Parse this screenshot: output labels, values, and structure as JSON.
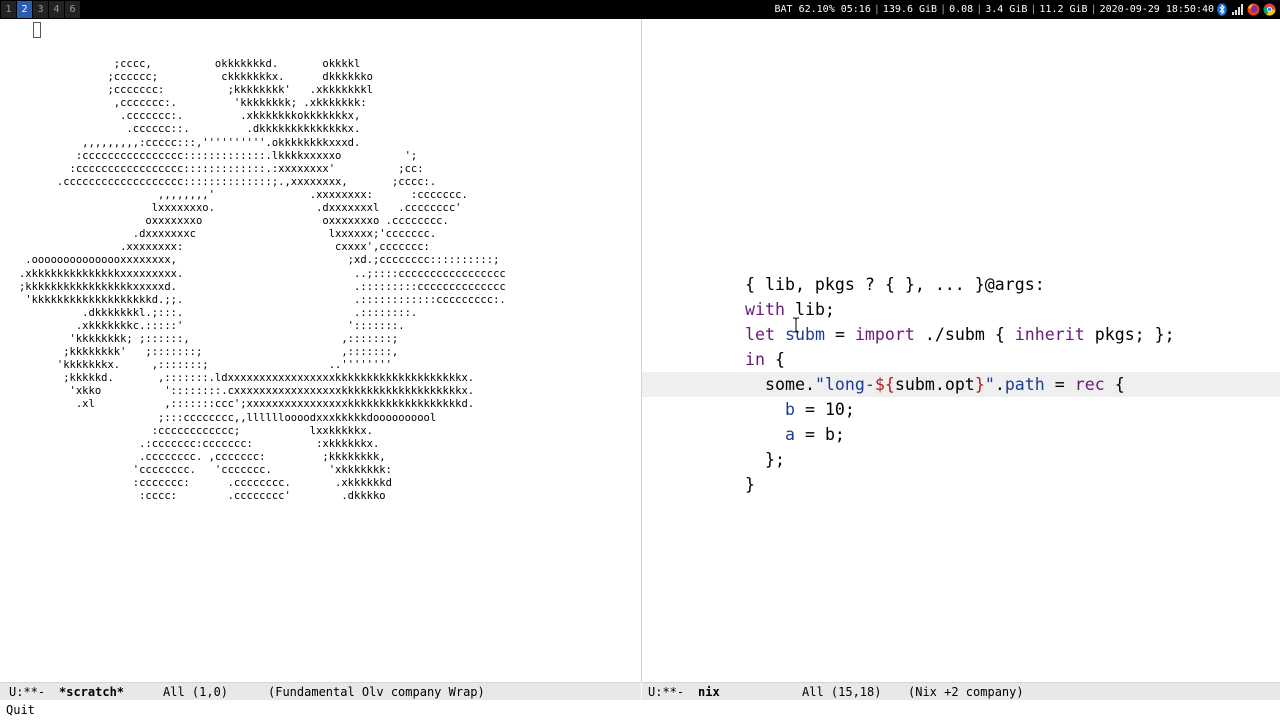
{
  "topbar": {
    "workspaces": [
      "1",
      "2",
      "3",
      "4",
      "6"
    ],
    "active_workspace": "2",
    "status": [
      "BAT 62.10% 05:16",
      "139.6 GiB",
      "0.08",
      "3.4 GiB",
      "11.2 GiB",
      "2020-09-29 18:50:40"
    ],
    "tray_icons": [
      "bluetooth-icon",
      "signal-icon",
      "firefox-icon",
      "chrome-icon"
    ]
  },
  "left_pane": {
    "ascii_art": [
      "                  ;cccc,          okkkkkkkd.       okkkkl",
      "                 ;cccccc;          ckkkkkkkx.      dkkkkkko",
      "                 ;ccccccc:          ;kkkkkkkk'   .xkkkkkkkl",
      "                  ,ccccccc:.         'kkkkkkkk; .xkkkkkkk:",
      "                   .ccccccc:.         .xkkkkkkkokkkkkkkx,",
      "                    .cccccc::.         .dkkkkkkkkkkkkkkx.",
      "             ,,,,,,,,,:ccccc:::,''''''''''.okkkkkkkkxxxd.",
      "            :cccccccccccccccc:::::::::::::.lkkkkxxxxxo          ';",
      "           :ccccccccccccccccc:::::::::::::.:xxxxxxxx'          ;cc:",
      "         .ccccccccccccccccccc::::::::::::::;.,xxxxxxxx,       ;cccc:.",
      "                         ,,,,,,,,'               .xxxxxxxx:      :ccccccc.",
      "                        lxxxxxxxo.                .dxxxxxxxl   .cccccccc'",
      "                       oxxxxxxxo                   oxxxxxxxo .cccccccc.",
      "                     .dxxxxxxxc                     lxxxxxx;'ccccccc.",
      "                   .xxxxxxxx:                        cxxxx',ccccccc:",
      "    .ooooooooooooooxxxxxxxx,                           ;xd.;cccccccc::::::::::;",
      "   .xkkkkkkkkkkkkkkxxxxxxxxx.                           ..;::::ccccccccccccccccc",
      "   ;kkkkkkkkkkkkkkkkkxxxxxd.                            .:::::::::cccccccccccccc",
      "    'kkkkkkkkkkkkkkkkkkkd.;;.                           .::::::::::::ccccccccc:.",
      "             .dkkkkkkkl.;:::.                           .::::::::.",
      "            .xkkkkkkkc.:::::'                          ':::::::.",
      "           'kkkkkkkk; ;::::::,                        ,:::::::;",
      "          ;kkkkkkkk'   ;:::::::;                      ,:::::::,",
      "         'kkkkkkkx.     ,:::::::;                   ..''''''''",
      "          ;kkkkkd.       ,:::::::.ldxxxxxxxxxxxxxxxxxkkkkkkkkkkkkkkkkkkkkx.",
      "           'xkko          '::::::::.cxxxxxxxxxxxxxxxxxkkkkkkkkkkkkkkkkkkkx.",
      "            .xl           ,:::::::ccc';xxxxxxxxxxxxxxxxkkkkkkkkkkkkkkkkkkd.",
      "                         ;:::cccccccc,,lllllloooodxxxkkkkkdoooooooool",
      "                        :cccccccccccc;           lxxkkkkkx.",
      "                      .:ccccccc:ccccccc:          :xkkkkkkx.",
      "                      .cccccccc. ,ccccccc:         ;kkkkkkkk,",
      "                     'cccccccc.   'ccccccc.         'xkkkkkkk:",
      "                     :ccccccc:      .cccccccc.       .xkkkkkkd",
      "                      :cccc:        .cccccccc'        .dkkkko"
    ]
  },
  "right_pane": {
    "code_lines": [
      [
        [
          "plain",
          "{ lib, pkgs ? { }, ... }@args:"
        ]
      ],
      [
        [
          "kw",
          "with"
        ],
        [
          "plain",
          " lib;"
        ]
      ],
      [
        [
          "kw",
          "let"
        ],
        [
          "plain",
          " "
        ],
        [
          "var",
          "subm"
        ],
        [
          "plain",
          " = "
        ],
        [
          "func",
          "import"
        ],
        [
          "plain",
          " ./subm { "
        ],
        [
          "kw",
          "inherit"
        ],
        [
          "plain",
          " pkgs; };"
        ]
      ],
      [
        [
          "kw",
          "in"
        ],
        [
          "plain",
          " {"
        ]
      ],
      [
        [
          "plain",
          "  some."
        ],
        [
          "str",
          "\"l"
        ],
        [
          "str",
          "ong-"
        ],
        [
          "interp",
          "${"
        ],
        [
          "plain",
          "subm.opt"
        ],
        [
          "interp",
          "}"
        ],
        [
          "str",
          "\""
        ],
        [
          "plain",
          "."
        ],
        [
          "attr",
          "path"
        ],
        [
          "plain",
          " = "
        ],
        [
          "kw",
          "rec"
        ],
        [
          "plain",
          " {"
        ]
      ],
      [
        [
          "plain",
          "    "
        ],
        [
          "attr",
          "b"
        ],
        [
          "plain",
          " = 10;"
        ]
      ],
      [
        [
          "plain",
          "    "
        ],
        [
          "attr",
          "a"
        ],
        [
          "plain",
          " = b;"
        ]
      ],
      [
        [
          "plain",
          "  };"
        ]
      ],
      [
        [
          "plain",
          "}"
        ]
      ]
    ],
    "current_line": 4
  },
  "modeline_left": {
    "state": "U:**-",
    "buffer": "*scratch*",
    "position": "All (1,0)",
    "modes": "(Fundamental Olv company Wrap)"
  },
  "modeline_right": {
    "state": "U:**-",
    "buffer": "nix",
    "position": "All (15,18)",
    "modes": "(Nix +2 company)"
  },
  "minibuffer": {
    "message": "Quit"
  },
  "colors": {
    "keyword": "#6a1b7a",
    "string": "#1a3c96",
    "interpolation": "#b01c1c",
    "active_workspace": "#2a5db0"
  }
}
